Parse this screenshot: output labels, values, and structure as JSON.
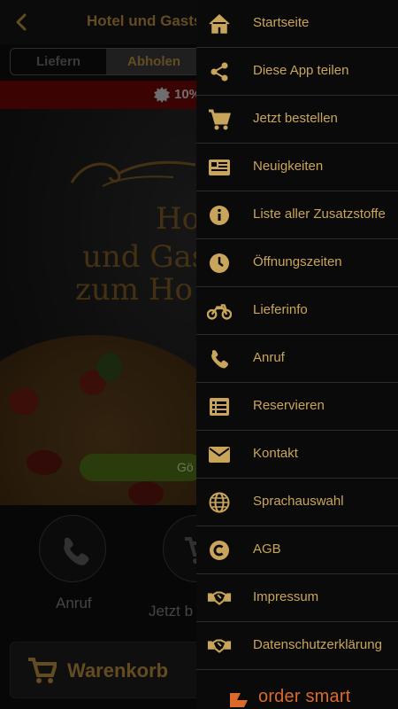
{
  "header": {
    "title": "Hotel und Gasts"
  },
  "order_mode": {
    "options": [
      "Liefern",
      "Abholen"
    ],
    "selected": "Abholen"
  },
  "promo": {
    "text": "10%"
  },
  "hero": {
    "line1": "Ho",
    "line2": "und Gas",
    "line3": "zum Ho",
    "open_button": "Gö"
  },
  "actions": {
    "call_label": "Anruf",
    "order_label": "Jetzt b"
  },
  "cart": {
    "label": "Warenkorb"
  },
  "drawer": {
    "items": [
      {
        "label": "Startseite",
        "icon": "home-icon"
      },
      {
        "label": "Diese App teilen",
        "icon": "share-icon"
      },
      {
        "label": "Jetzt bestellen",
        "icon": "cart-icon"
      },
      {
        "label": "Neuigkeiten",
        "icon": "news-icon"
      },
      {
        "label": "Liste aller Zusatzstoffe",
        "icon": "info-icon"
      },
      {
        "label": "Öffnungszeiten",
        "icon": "clock-icon"
      },
      {
        "label": "Lieferinfo",
        "icon": "motorcycle-icon"
      },
      {
        "label": "Anruf",
        "icon": "phone-icon"
      },
      {
        "label": "Reservieren",
        "icon": "list-icon"
      },
      {
        "label": "Kontakt",
        "icon": "mail-icon"
      },
      {
        "label": "Sprachauswahl",
        "icon": "globe-icon"
      },
      {
        "label": "AGB",
        "icon": "copyright-icon"
      },
      {
        "label": "Impressum",
        "icon": "handshake-icon"
      },
      {
        "label": "Datenschutzerklärung",
        "icon": "handshake-icon"
      }
    ],
    "brand": "order smart"
  },
  "colors": {
    "accent": "#c9a55c",
    "brand": "#dc6a2a",
    "promo_bg": "#6e0707"
  }
}
